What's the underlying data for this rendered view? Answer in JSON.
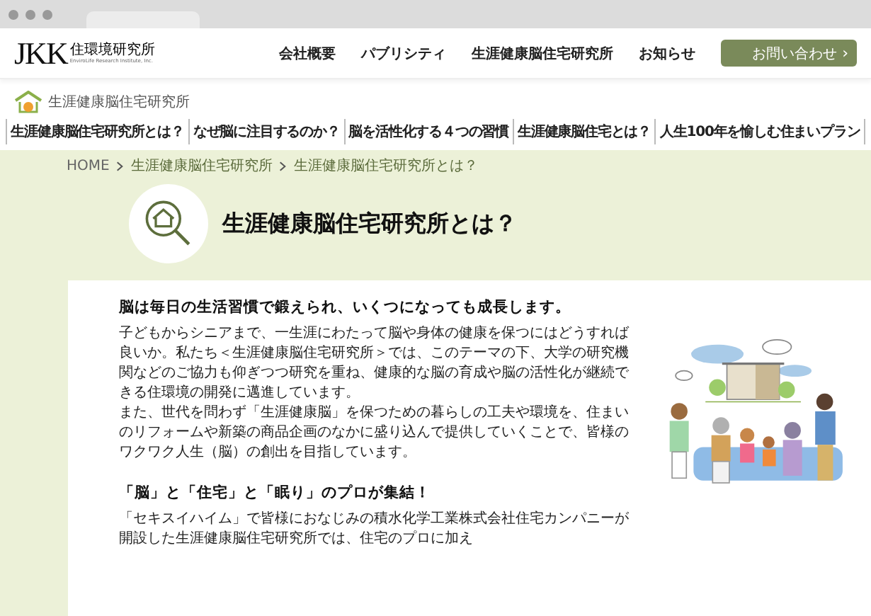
{
  "logo": {
    "mark": "JKK",
    "name": "住環境研究所",
    "subtitle": "EnviroLife Research Institute, Inc."
  },
  "header_nav": [
    "会社概要",
    "パブリシティ",
    "生涯健康脳住宅研究所",
    "お知らせ"
  ],
  "contact_button": {
    "label": "お問い合わせ",
    "arrow": "›"
  },
  "sub_brand": "生涯健康脳住宅研究所",
  "sub_nav": [
    "生涯健康脳住宅研究所とは？",
    "なぜ脳に注目するのか？",
    "脳を活性化する４つの習慣",
    "生涯健康脳住宅とは？",
    "人生100年を愉しむ住まいプラン"
  ],
  "breadcrumb": [
    {
      "label": "HOME"
    },
    {
      "label": "生涯健康脳住宅研究所"
    },
    {
      "label": "生涯健康脳住宅研究所とは？"
    }
  ],
  "page_title": "生涯健康脳住宅研究所とは？",
  "sections": [
    {
      "heading": "脳は毎日の生活習慣で鍛えられ、いくつになっても成長します。",
      "paragraphs": [
        "子どもからシニアまで、一生涯にわたって脳や身体の健康を保つにはどうすれば良いか。私たち＜生涯健康脳住宅研究所＞では、このテーマの下、大学の研究機関などのご協力も仰ぎつつ研究を重ね、健康的な脳の育成や脳の活性化が継続できる住環境の開発に邁進しています。",
        "また、世代を問わず「生涯健康脳」を保つための暮らしの工夫や環境を、住まいのリフォームや新築の商品企画のなかに盛り込んで提供していくことで、皆様のワクワク人生（脳）の創出を目指しています。"
      ]
    },
    {
      "heading": "「脳」と「住宅」と「眠り」のプロが集結！",
      "paragraphs": [
        "「セキスイハイム」で皆様におなじみの積水化学工業株式会社住宅カンパニーが開設した生涯健康脳住宅研究所では、住宅のプロに加え"
      ]
    }
  ]
}
